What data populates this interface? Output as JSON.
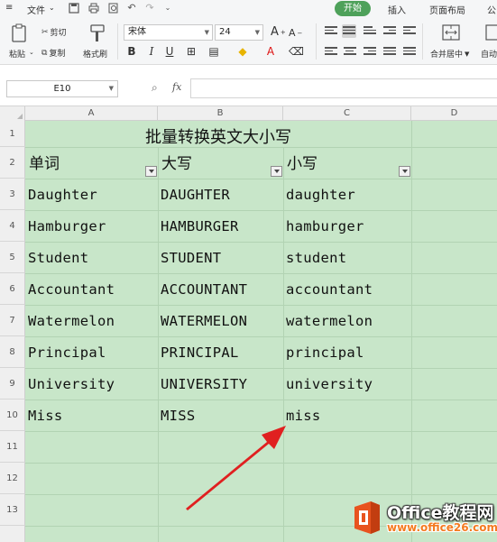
{
  "menubar": {
    "menu_icon": "≡",
    "file_label": "文件",
    "file_chevron": "⌄",
    "tabs": [
      {
        "label": "开始",
        "active": true
      },
      {
        "label": "插入",
        "active": false
      },
      {
        "label": "页面布局",
        "active": false
      },
      {
        "label": "公",
        "active": false
      }
    ]
  },
  "toolbar": {
    "paste_label": "粘贴",
    "cut_label": "剪切",
    "copy_label": "复制",
    "format_painter_label": "格式刷",
    "font_name": "宋体",
    "font_size": "24",
    "grow_font": "A",
    "shrink_font": "A",
    "bold": "B",
    "italic": "I",
    "underline": "U",
    "font_color_glyph": "A",
    "merge_center_label": "合并居中",
    "autowrap_label": "自动"
  },
  "formula_bar": {
    "name_box": "E10",
    "zoom_icon": "⌕",
    "fx_label": "fx",
    "formula_value": ""
  },
  "columns": [
    "A",
    "B",
    "C",
    "D"
  ],
  "rows": [
    "1",
    "2",
    "3",
    "4",
    "5",
    "6",
    "7",
    "8",
    "9",
    "10",
    "11",
    "12",
    "13"
  ],
  "sheet": {
    "title": "批量转换英文大小写",
    "headers": [
      "单词",
      "大写",
      "小写"
    ],
    "data": [
      [
        "Daughter",
        "DAUGHTER",
        "daughter"
      ],
      [
        "Hamburger",
        "HAMBURGER",
        "hamburger"
      ],
      [
        "Student",
        "STUDENT",
        "student"
      ],
      [
        "Accountant",
        "ACCOUNTANT",
        "accountant"
      ],
      [
        "Watermelon",
        "WATERMELON",
        "watermelon"
      ],
      [
        "Principal",
        "PRINCIPAL",
        "principal"
      ],
      [
        "University",
        "UNIVERSITY",
        "university"
      ],
      [
        "Miss",
        "MISS",
        "miss"
      ]
    ]
  },
  "colors": {
    "cell_fill": "#c8e6c9",
    "accent_green": "#4ea15a",
    "arrow_red": "#e02020"
  },
  "watermark": {
    "brand": "Office教程网",
    "url": "www.office26.com"
  }
}
